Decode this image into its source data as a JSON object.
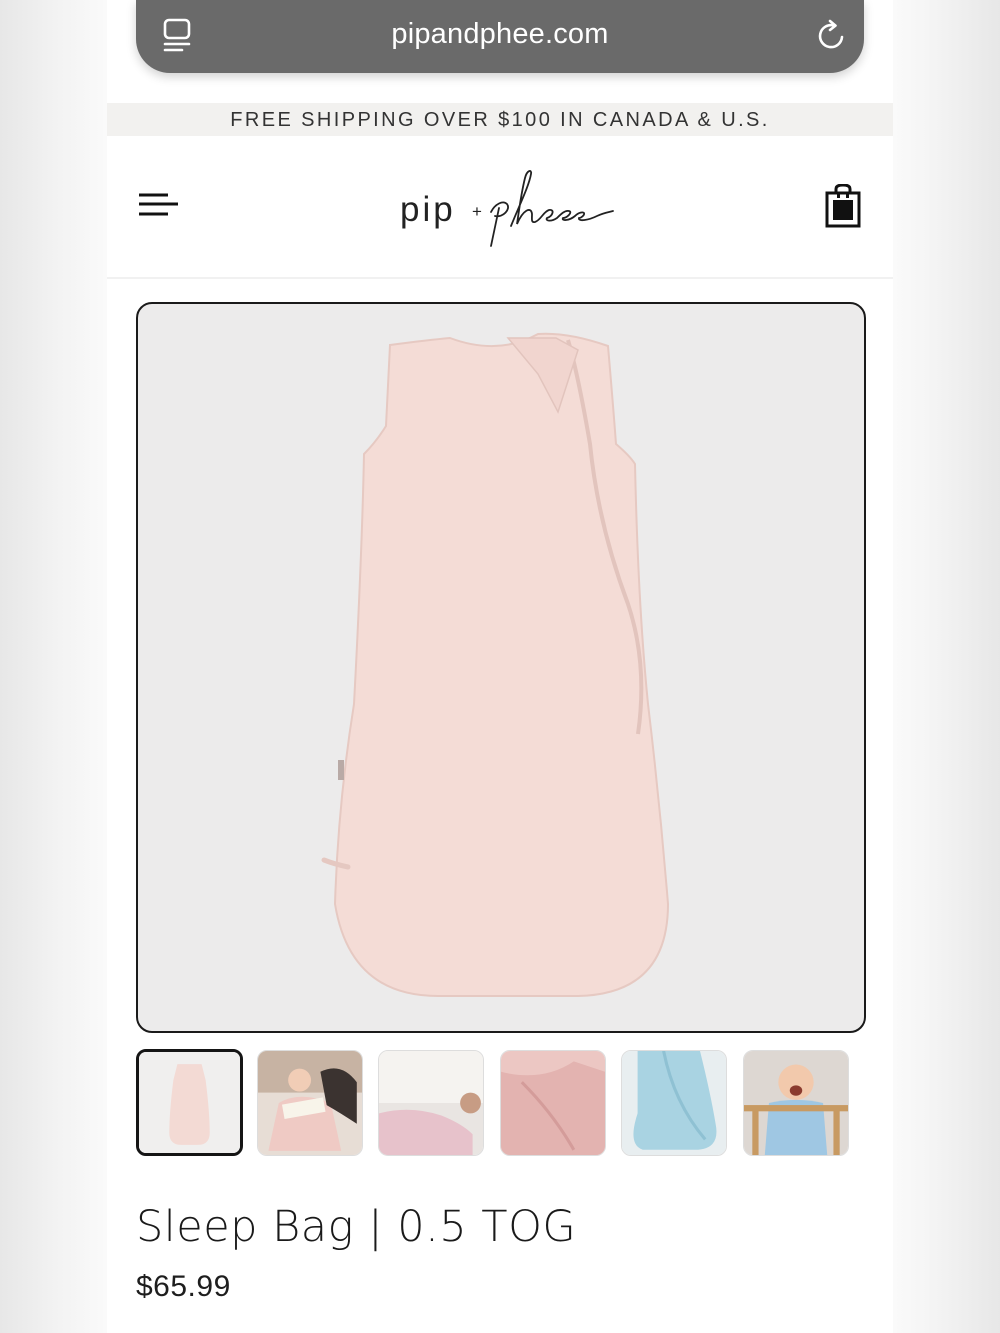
{
  "browser": {
    "url": "pipandphee.com",
    "tabs_icon": "tab-overview-icon",
    "reload_icon": "reload-icon"
  },
  "banner": {
    "text": "FREE SHIPPING OVER $100 IN CANADA & U.S."
  },
  "header": {
    "menu_icon": "hamburger-menu-icon",
    "logo": {
      "part1": "pip",
      "plus": "+",
      "part2": "phee"
    },
    "cart_icon": "shopping-bag-icon"
  },
  "product": {
    "title": "Sleep Bag | 0.5 TOG",
    "price": "$65.99",
    "main_image": "pink sleep bag",
    "thumbnails": [
      {
        "name": "pink sleep bag product shot",
        "selected": true
      },
      {
        "name": "parent reading to baby in pink sleep bag",
        "selected": false
      },
      {
        "name": "baby sleeping in pink sleep bag",
        "selected": false
      },
      {
        "name": "close-up of pink sleep bag fabric",
        "selected": false
      },
      {
        "name": "blue sleep bag",
        "selected": false
      },
      {
        "name": "smiling baby in blue sleep bag at crib",
        "selected": false
      }
    ]
  },
  "colors": {
    "accent": "#1a1a1a",
    "bag_pink": "#f4dcd6",
    "image_bg": "#ecebeb",
    "banner_bg": "#f2f1ef",
    "addr_bar": "#6a6a6a"
  }
}
